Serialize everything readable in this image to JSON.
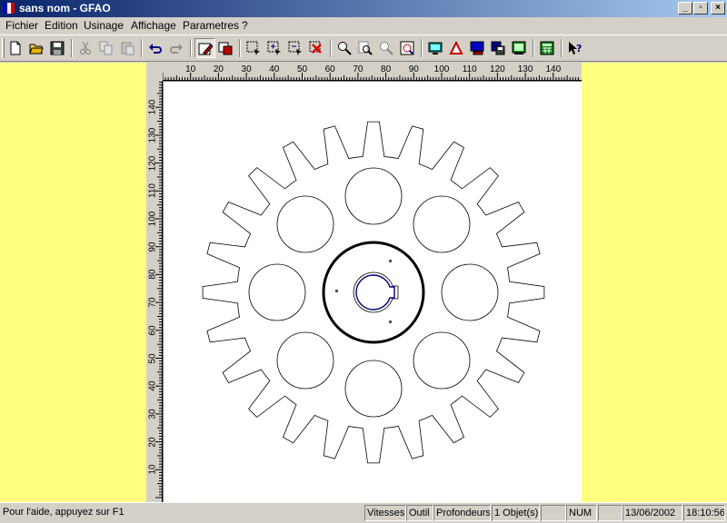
{
  "window": {
    "title": "sans nom - GFAO"
  },
  "menu": [
    "Fichier",
    "Edition",
    "Usinage",
    "Affichage",
    "Parametres",
    "?"
  ],
  "toolbar": {
    "icons": [
      "new-file-icon",
      "open-folder-icon",
      "save-icon",
      "cut-icon",
      "copy-icon",
      "paste-icon",
      "undo-icon",
      "redo-icon",
      "draw-pencil-icon",
      "color-fill-icon",
      "select-icon",
      "select-add-icon",
      "select-remove-icon",
      "delete-icon",
      "zoom-icon",
      "zoom-window-icon",
      "zoom-pan-icon",
      "zoom-all-icon",
      "display-icon",
      "tool-icon",
      "monitor-icon",
      "disk-icon",
      "simulation-icon",
      "calculator-icon",
      "context-help-icon"
    ]
  },
  "ruler": {
    "h_labels": [
      "10",
      "20",
      "30",
      "40",
      "50",
      "60",
      "70",
      "80",
      "90",
      "100",
      "110",
      "120",
      "130",
      "140"
    ],
    "v_labels": [
      "140",
      "130",
      "120",
      "110",
      "100",
      "90",
      "80",
      "70",
      "60",
      "50",
      "40",
      "30",
      "20",
      "10"
    ]
  },
  "drawing": {
    "gear_teeth": 24,
    "hole_count": 8
  },
  "status": {
    "message": "Pour l'aide, appuyez sur F1",
    "vitesses": "Vitesses",
    "outil": "Outil",
    "profondeurs": "Profondeurs",
    "objets": "1 Objet(s)",
    "num": "NUM",
    "date": "13/06/2002",
    "time": "18:10:56"
  },
  "colors": {
    "workspace": "#ffff80",
    "canvas": "#ffffff",
    "selection": "#000080",
    "titlebar": "#0a246a"
  }
}
